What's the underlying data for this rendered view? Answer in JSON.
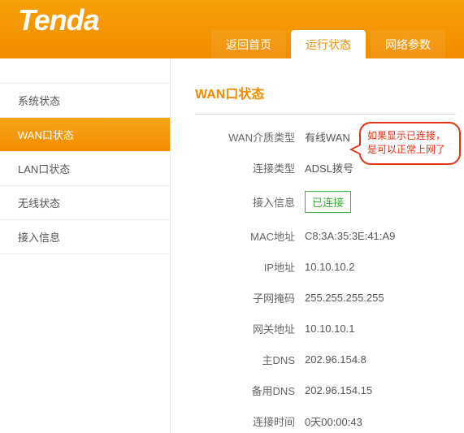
{
  "brand": "Tenda",
  "tabs": {
    "home": "返回首页",
    "status": "运行状态",
    "network": "网络参数"
  },
  "sidebar": {
    "items": [
      {
        "label": "系统状态"
      },
      {
        "label": "WAN口状态"
      },
      {
        "label": "LAN口状态"
      },
      {
        "label": "无线状态"
      },
      {
        "label": "接入信息"
      }
    ]
  },
  "panel": {
    "title": "WAN口状态",
    "rows": {
      "media_label": "WAN介质类型",
      "media_value": "有线WAN",
      "conn_type_label": "连接类型",
      "conn_type_value": "ADSL拨号",
      "access_label": "接入信息",
      "access_value": "已连接",
      "mac_label": "MAC地址",
      "mac_value": "C8:3A:35:3E:41:A9",
      "ip_label": "IP地址",
      "ip_value": "10.10.10.2",
      "mask_label": "子网掩码",
      "mask_value": "255.255.255.255",
      "gw_label": "网关地址",
      "gw_value": "10.10.10.1",
      "dns1_label": "主DNS",
      "dns1_value": "202.96.154.8",
      "dns2_label": "备用DNS",
      "dns2_value": "202.96.154.15",
      "time_label": "连接时间",
      "time_value": "0天00:00:43"
    }
  },
  "callout": "如果显示已连接，是可以正常上网了"
}
